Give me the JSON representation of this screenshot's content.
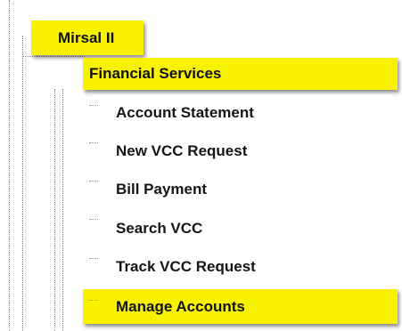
{
  "tree": {
    "root_label": "Mirsal II",
    "group_label": "Financial Services",
    "items": [
      {
        "label": "Account Statement"
      },
      {
        "label": "New VCC Request"
      },
      {
        "label": "Bill Payment"
      },
      {
        "label": "Search VCC"
      },
      {
        "label": "Track VCC Request"
      },
      {
        "label": "Manage Accounts"
      }
    ]
  },
  "colors": {
    "highlight": "#f8f200",
    "text": "#111111",
    "connector": "#8a8a8a"
  }
}
